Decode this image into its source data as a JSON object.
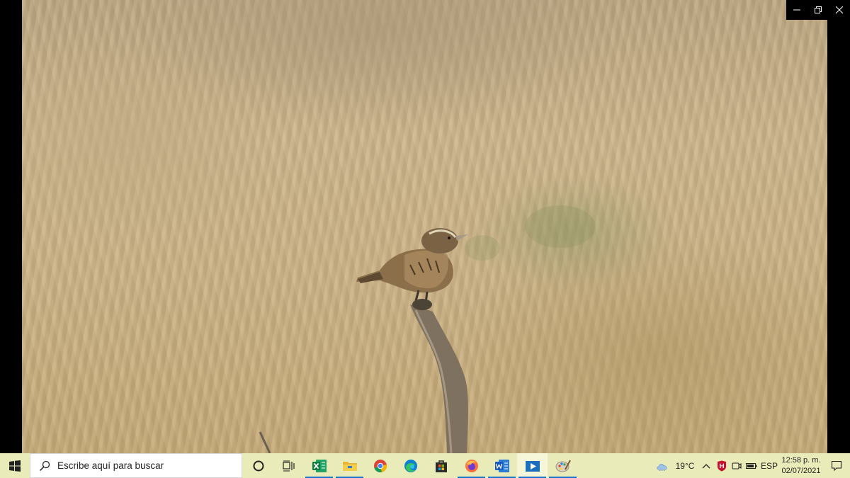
{
  "window": {
    "minimize_icon": "minimize-icon",
    "restore_icon": "restore-icon",
    "close_icon": "close-icon"
  },
  "taskbar": {
    "search_placeholder": "Escribe aquí para buscar",
    "apps": [
      {
        "name": "cortana-icon"
      },
      {
        "name": "task-view-icon"
      },
      {
        "name": "excel-icon",
        "active": true
      },
      {
        "name": "file-explorer-icon",
        "active": true
      },
      {
        "name": "chrome-icon"
      },
      {
        "name": "edge-icon"
      },
      {
        "name": "store-icon"
      },
      {
        "name": "firefox-icon",
        "active": true
      },
      {
        "name": "word-icon",
        "active": true
      },
      {
        "name": "photos-icon",
        "active": true
      },
      {
        "name": "paint-icon",
        "active": true
      }
    ],
    "tray": {
      "weather": "19°C",
      "language": "ESP",
      "time": "12:58 p. m.",
      "date": "02/07/2021"
    }
  },
  "colors": {
    "taskbar_bg": "#e9ebb9",
    "accent": "#1a76c8"
  }
}
